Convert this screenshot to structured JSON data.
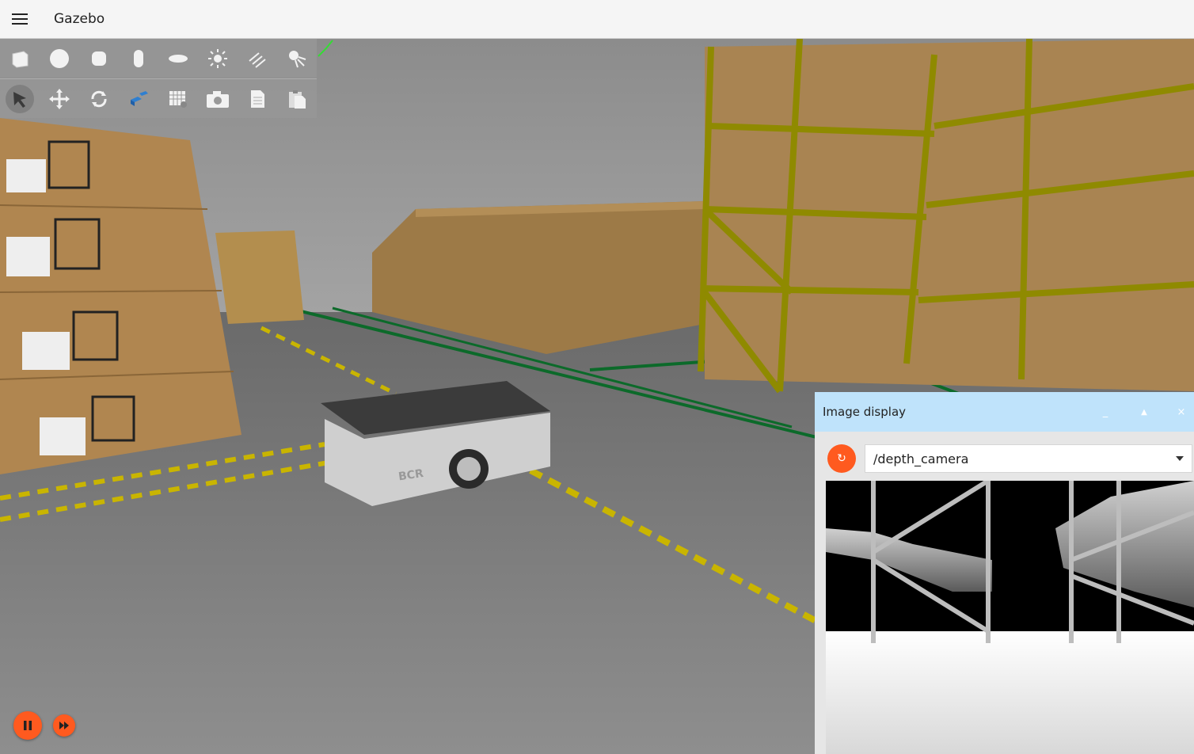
{
  "app": {
    "title": "Gazebo"
  },
  "toolbar": {
    "shapes": [
      {
        "name": "box-icon"
      },
      {
        "name": "sphere-icon"
      },
      {
        "name": "cylinder-icon"
      },
      {
        "name": "capsule-icon"
      },
      {
        "name": "ellipsoid-icon"
      },
      {
        "name": "sun-light-icon"
      },
      {
        "name": "directional-light-icon"
      },
      {
        "name": "spot-light-icon"
      }
    ],
    "tools": [
      {
        "name": "select-icon"
      },
      {
        "name": "translate-icon"
      },
      {
        "name": "rotate-icon"
      },
      {
        "name": "transform-control-icon"
      },
      {
        "name": "grid-snap-icon"
      },
      {
        "name": "screenshot-icon"
      },
      {
        "name": "copy-icon"
      },
      {
        "name": "paste-icon"
      }
    ]
  },
  "scene": {
    "robot_label": "BCR"
  },
  "image_display": {
    "title": "Image display",
    "minimize_label": "_",
    "maximize_label": "▲",
    "close_label": "×",
    "refresh_icon": "↻",
    "topic": "/depth_camera"
  },
  "colors": {
    "accent": "#ff5a1f",
    "panel_header": "#bfe3fb",
    "rack": "#8f8a00"
  }
}
